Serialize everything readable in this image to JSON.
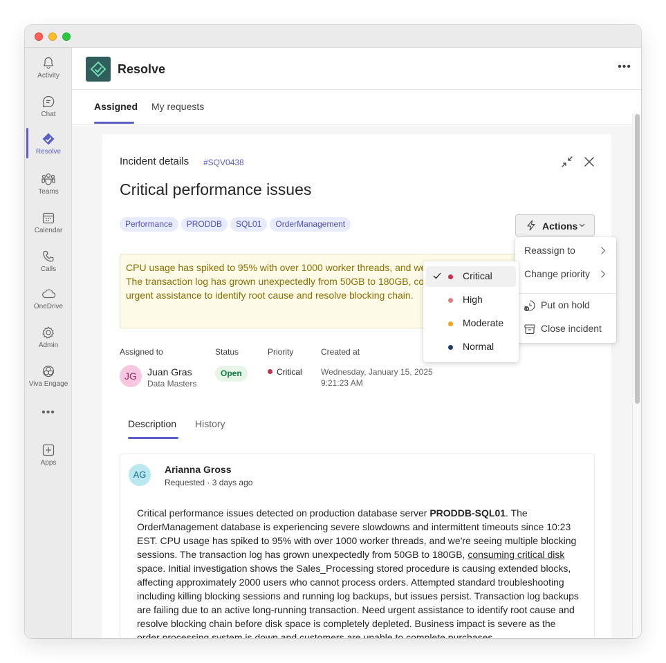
{
  "rail": {
    "items": [
      {
        "label": "Activity"
      },
      {
        "label": "Chat"
      },
      {
        "label": "Resolve"
      },
      {
        "label": "Teams"
      },
      {
        "label": "Calendar"
      },
      {
        "label": "Calls"
      },
      {
        "label": "OneDrive"
      },
      {
        "label": "Admin"
      },
      {
        "label": "Viva Engage"
      },
      {
        "label": "Apps"
      }
    ],
    "more": "•••",
    "accent": "#5b5fc7"
  },
  "header": {
    "title": "Resolve",
    "more": "•••"
  },
  "tabs": {
    "assigned": "Assigned",
    "my_requests": "My requests"
  },
  "incident": {
    "title_label": "Incident details",
    "id": "#SQV0438",
    "heading": "Critical performance issues",
    "tags": [
      "Performance",
      "PRODDB",
      "SQL01",
      "OrderManagement"
    ],
    "actions_label": "Actions",
    "alert": "CPU usage has spiked to 95% with over 1000 worker threads, and we're seeing multiple blocking\nThe transaction log has grown unexpectedly from 50GB to 180GB, consuming critical disk space.\nurgent assistance to identify root cause and resolve blocking chain.",
    "meta": {
      "assigned_to_label": "Assigned to",
      "status_label": "Status",
      "priority_label": "Priority",
      "created_label": "Created at",
      "assignee_initials": "JG",
      "assignee_name": "Juan Gras",
      "assignee_org": "Data Masters",
      "status": "Open",
      "priority": "Critical",
      "created": "Wednesday, January 15, 2025\n9:21:23 AM"
    },
    "detail_tabs": {
      "description": "Description",
      "history": "History"
    }
  },
  "comment": {
    "initials": "AG",
    "author": "Arianna Gross",
    "sub": "Requested · 3 days ago",
    "body_p1": "Critical performance issues detected on production database server ",
    "body_bold": "PRODDB-SQL01",
    "body_p2": ". The OrderManagement database is experiencing severe slowdowns and intermittent timeouts since 10:23 EST. CPU usage has spiked to 95% with over 1000 worker threads, and we're seeing multiple blocking sessions. The transaction log has grown unexpectedly from 50GB to 180GB, ",
    "body_link": "consuming critical disk",
    "body_p3": " space. Initial investigation shows the Sales_Processing stored procedure is causing extended blocks, affecting approximately 2000 users who cannot process orders. Attempted standard troubleshooting including killing blocking sessions and running log backups, but issues persist. Transaction log backups are failing due to an active long-running transaction. Need urgent assistance to identify root cause and resolve blocking chain before disk space is completely depleted. Business impact is severe as the order processing system is down and customers are unable to complete purchases."
  },
  "actions_menu": {
    "reassign": "Reassign to",
    "change_priority": "Change priority",
    "put_on_hold": "Put on hold",
    "close_incident": "Close incident"
  },
  "priority_menu": {
    "items": [
      {
        "label": "Critical",
        "color": "#c4314b"
      },
      {
        "label": "High",
        "color": "#e37d80"
      },
      {
        "label": "Moderate",
        "color": "#f2a41f"
      },
      {
        "label": "Normal",
        "color": "#1f3f6b"
      }
    ],
    "selected": "Critical"
  }
}
